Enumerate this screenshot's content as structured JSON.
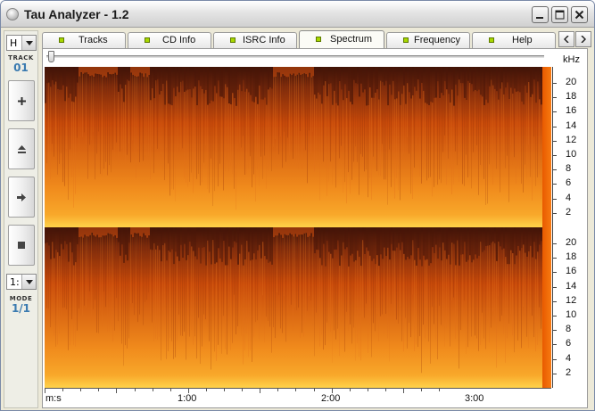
{
  "window": {
    "title": "Tau Analyzer - 1.2"
  },
  "icons": {
    "app": "app-orb-icon",
    "minimize": "minimize-icon",
    "maximize": "maximize-icon",
    "close": "close-icon",
    "tab_prev": "chevron-left-icon",
    "tab_next": "chevron-right-icon",
    "next_track": "plus-icon",
    "eject": "eject-icon",
    "play": "play-icon",
    "stop": "stop-icon"
  },
  "tabs": [
    {
      "label": "Tracks",
      "active": false
    },
    {
      "label": "CD Info",
      "active": false
    },
    {
      "label": "ISRC Info",
      "active": false
    },
    {
      "label": "Spectrum",
      "active": true
    },
    {
      "label": "Frequency",
      "active": false
    },
    {
      "label": "Help",
      "active": false
    }
  ],
  "sidebar": {
    "channel_select": {
      "value": "H"
    },
    "track_label": "TRACK",
    "track_value": "01",
    "mode_select": {
      "value": "1:"
    },
    "mode_label": "MODE",
    "mode_value": "1/1"
  },
  "spectrum": {
    "unit_label": "kHz",
    "playback_position": 0.0,
    "freq_ticks": [
      "20",
      "18",
      "16",
      "14",
      "12",
      "10",
      "8",
      "6",
      "4",
      "2"
    ],
    "time_axis": {
      "origin_label": "m:s",
      "ticks": [
        "1:00",
        "2:00",
        "3:00"
      ]
    },
    "colors": {
      "dark": "#3a1208",
      "mid": "#c84a0a",
      "bright": "#f08a1c",
      "hot": "#ffd24a"
    }
  }
}
